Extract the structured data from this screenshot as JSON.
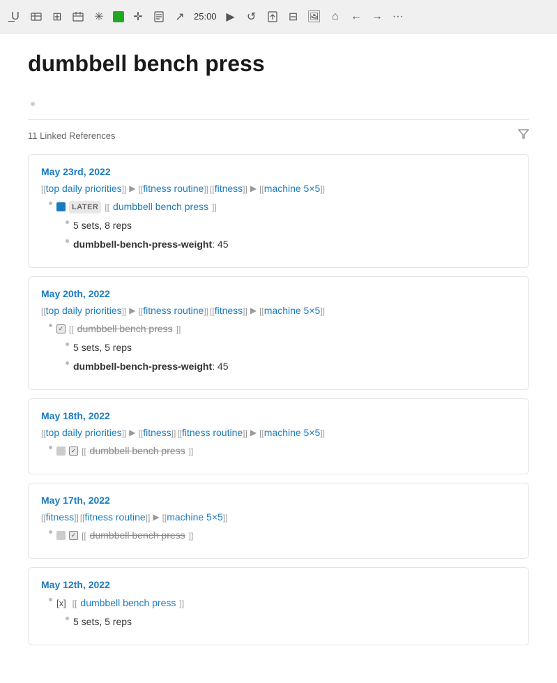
{
  "toolbar": {
    "timer": "25:00",
    "icons": [
      "underline",
      "table",
      "grid",
      "calendar",
      "asterisk",
      "square-green",
      "crosshair",
      "doc",
      "cursor",
      "play",
      "refresh",
      "upload",
      "layout",
      "image",
      "home",
      "back",
      "forward",
      "more"
    ]
  },
  "page": {
    "title": "dumbbell bench press",
    "linked_refs_label": "11 Linked References"
  },
  "references": [
    {
      "date": "May 23rd, 2022",
      "breadcrumb": [
        {
          "text": "top daily priorities",
          "bracket": true
        },
        {
          "sep": "▶"
        },
        {
          "text": "fitness routine",
          "bracket": true
        },
        {
          "text": "fitness",
          "bracket": true
        },
        {
          "sep": "▶"
        },
        {
          "text": "machine 5×5",
          "bracket": true
        }
      ],
      "items": [
        {
          "type": "later-checkbox",
          "label": "LATER",
          "text": "dumbbell bench press",
          "strikethrough": false
        },
        {
          "type": "sub-bullet",
          "text": "5 sets, 8 reps"
        },
        {
          "type": "sub-bullet",
          "text": "dumbbell-bench-press-weight",
          "suffix": ": 45",
          "bold_key": true
        }
      ]
    },
    {
      "date": "May 20th, 2022",
      "breadcrumb": [
        {
          "text": "top daily priorities",
          "bracket": true
        },
        {
          "sep": "▶"
        },
        {
          "text": "fitness routine",
          "bracket": true
        },
        {
          "text": "fitness",
          "bracket": true
        },
        {
          "sep": "▶"
        },
        {
          "text": "machine 5×5",
          "bracket": true
        }
      ],
      "items": [
        {
          "type": "checked-checkbox",
          "text": "dumbbell bench press",
          "strikethrough": true
        },
        {
          "type": "sub-bullet",
          "text": "5 sets, 5 reps"
        },
        {
          "type": "sub-bullet",
          "text": "dumbbell-bench-press-weight",
          "suffix": ": 45",
          "bold_key": true
        }
      ]
    },
    {
      "date": "May 18th, 2022",
      "breadcrumb": [
        {
          "text": "top daily priorities",
          "bracket": true
        },
        {
          "sep": "▶"
        },
        {
          "text": "fitness",
          "bracket": true
        },
        {
          "text": "fitness routine",
          "bracket": true
        },
        {
          "sep": "▶"
        },
        {
          "text": "machine 5×5",
          "bracket": true
        }
      ],
      "items": [
        {
          "type": "gray-checked-checkbox",
          "text": "dumbbell bench press",
          "strikethrough": true
        }
      ]
    },
    {
      "date": "May 17th, 2022",
      "breadcrumb": [
        {
          "text": "fitness",
          "bracket": true
        },
        {
          "text": "fitness routine",
          "bracket": true
        },
        {
          "sep": "▶"
        },
        {
          "text": "machine 5×5",
          "bracket": true
        }
      ],
      "items": [
        {
          "type": "gray-checked-checkbox",
          "text": "dumbbell bench press",
          "strikethrough": true
        }
      ]
    },
    {
      "date": "May 12th, 2022",
      "breadcrumb": [],
      "items": [
        {
          "type": "done-x",
          "text": "dumbbell bench press",
          "strikethrough": false
        },
        {
          "type": "sub-bullet",
          "text": "5 sets, 5 reps"
        }
      ]
    }
  ]
}
